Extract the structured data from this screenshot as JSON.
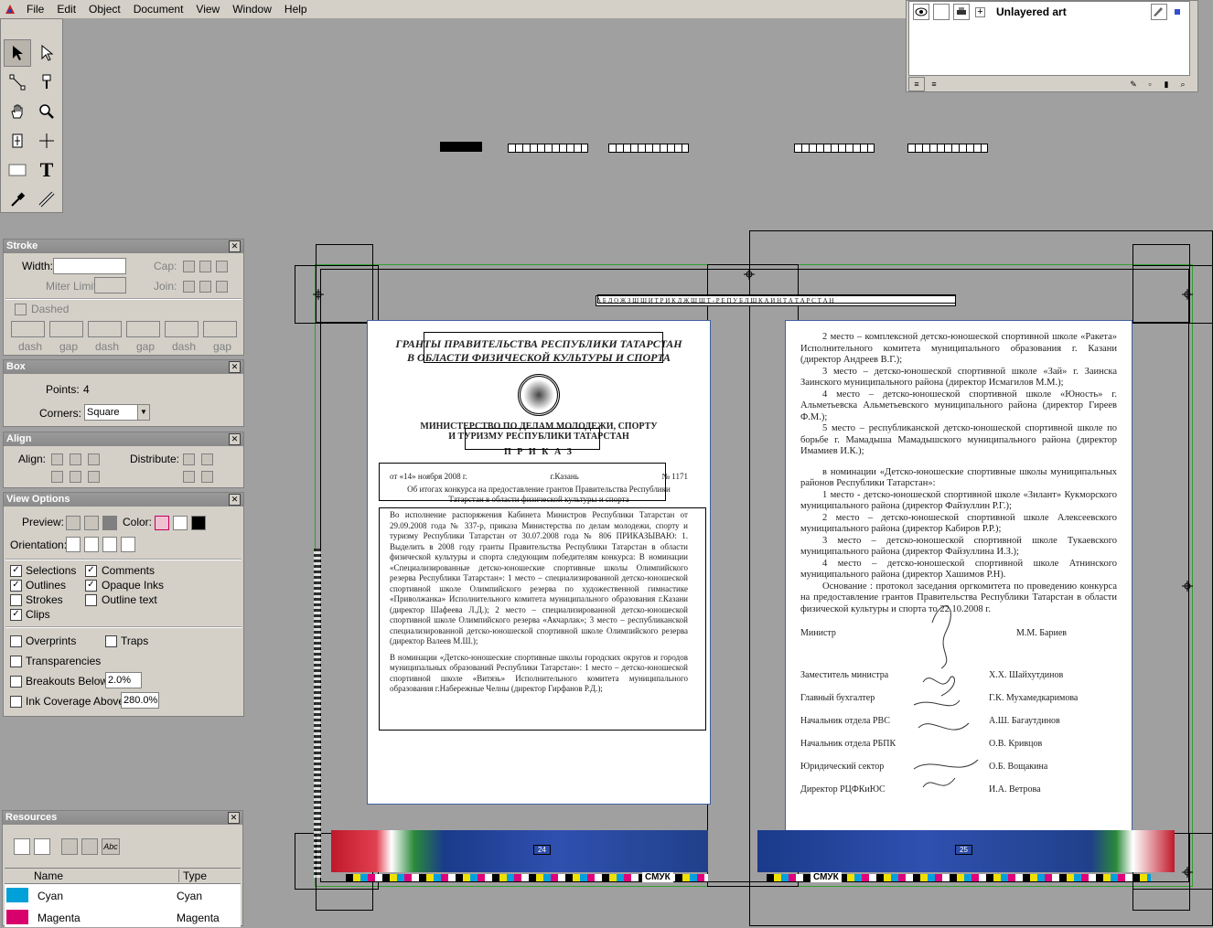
{
  "menubar": {
    "items": [
      "File",
      "Edit",
      "Object",
      "Document",
      "View",
      "Window",
      "Help"
    ]
  },
  "layers": {
    "layer_name": "Unlayered art"
  },
  "stroke_panel": {
    "title": "Stroke",
    "width_label": "Width:",
    "width_value": "",
    "cap_label": "Cap:",
    "miter_label": "Miter Limit:",
    "join_label": "Join:",
    "dashed_label": "Dashed",
    "dash_labels": [
      "dash",
      "gap",
      "dash",
      "gap",
      "dash",
      "gap"
    ]
  },
  "box_panel": {
    "title": "Box",
    "points_label": "Points:",
    "points_value": "4",
    "corners_label": "Corners:",
    "corners_value": "Square"
  },
  "align_panel": {
    "title": "Align",
    "align_label": "Align:",
    "distribute_label": "Distribute:"
  },
  "view_options": {
    "title": "View Options",
    "preview_label": "Preview:",
    "color_label": "Color:",
    "orientation_label": "Orientation:",
    "checks": [
      {
        "label": "Selections",
        "checked": true
      },
      {
        "label": "Comments",
        "checked": true
      },
      {
        "label": "Outlines",
        "checked": true
      },
      {
        "label": "Opaque Inks",
        "checked": true
      },
      {
        "label": "Strokes",
        "checked": false
      },
      {
        "label": "Outline text",
        "checked": false
      },
      {
        "label": "Clips",
        "checked": true
      }
    ],
    "overprints_label": "Overprints",
    "traps_label": "Traps",
    "transparencies_label": "Transparencies",
    "breakouts_label": "Breakouts Below",
    "breakouts_value": "2.0%",
    "ink_label": "Ink Coverage Above",
    "ink_value": "280.0%"
  },
  "resources": {
    "title": "Resources",
    "col_name": "Name",
    "col_type": "Type",
    "rows": [
      {
        "name": "Cyan",
        "type": "Cyan",
        "color": "#00a0d8"
      },
      {
        "name": "Magenta",
        "type": "Magenta",
        "color": "#d8006c"
      }
    ]
  },
  "document": {
    "left": {
      "title1": "ГРАНТЫ ПРАВИТЕЛЬСТВА РЕСПУБЛИКИ ТАТАРСТАН",
      "title2": "В ОБЛАСТИ ФИЗИЧЕСКОЙ КУЛЬТУРЫ И СПОРТА",
      "ministry1": "МИНИСТЕРСТВО ПО ДЕЛАМ МОЛОДЕЖИ, СПОРТУ",
      "ministry2": "И ТУРИЗМУ РЕСПУБЛИКИ ТАТАРСТАН",
      "prikaz": "П Р И К А З",
      "date": "от «14» ноября 2008 г.",
      "city": "г.Казань",
      "number": "№ 1171",
      "subject": "Об итогах конкурса на предоставление грантов Правительства Республики Татарстан в области физической культуры и спорта",
      "body": "Во исполнение распоряжения Кабинета Министров Республики Татарстан от 29.09.2008 года № 337-р, приказа Министерства по делам молодежи, спорту и туризму Республики Татарстан от 30.07.2008 года № 806 ПРИКАЗЫВАЮ: 1. Выделить в 2008 году гранты Правительства Республики Татарстан в области физической культуры и спорта следующим победителям конкурса: В номинации «Специализированные детско-юношеские спортивные школы Олимпийского резерва Республики Татарстан»: 1 место – специализированной детско-юношеской спортивной школе Олимпийского резерва по художественной гимнастике «Приволжанка» Исполнительного комитета муниципального образования г.Казани (директор Шафеева Л.Д.); 2 место – специализированной детско-юношеской спортивной школе Олимпийского резерва «Акчарлак»; 3 место – республиканской специализированной детско-юношеской спортивной школе Олимпийского резерва (директор Валеев М.Ш.);",
      "body2": "В номинации «Детско-юношеские спортивные школы городских округов и городов муниципальных образований Республики Татарстан»: 1 место – детско-юношеской спортивной школе «Витязь» Исполнительного комитета муниципального образования г.Набережные Челны (директор Гирфанов Р.Д.);",
      "page_no": "24"
    },
    "right": {
      "header": "А Б Д О Ж З Ш Ш И Т Р И К Д Ж Ш Ш Т - Р Е П У Б Л Ш К А И Н Т А Т А Р С Т А Н",
      "p1": "2 место – комплексной детско-юношеской спортивной школе «Ракета» Исполнительного комитета муниципального образования г. Казани (директор Андреев В.Г.);",
      "p2": "3 место – детско-юношеской спортивной школе «Зай» г. Заинска Заинского муниципального района (директор Исмагилов М.М.);",
      "p3": "4 место – детско-юношеской спортивной школе «Юность» г. Альметьевска Альметьевского муниципального района (директор Гиреев Ф.М.);",
      "p4": "5 место – республиканской детско-юношеской спортивной школе по борьбе г. Мамадыша Мамадышского муниципального района (директор Имамиев И.К.);",
      "p5": "в номинации «Детско-юношеские спортивные школы муниципальных районов Республики Татарстан»:",
      "p6": "1 место - детско-юношеской спортивной школе «Зилант» Кукморского муниципального района (директор Файзуллин Р.Г.);",
      "p7": "2 место – детско-юношеской спортивной школе Алексеевского муниципального района (директор Кабиров Р.Р.);",
      "p8": "3 место – детско-юношеской спортивной школе Тукаевского муниципального района (директор Файзуллина И.З.);",
      "p9": "4 место – детско-юношеской спортивной школе Атнинского муниципального района (директор Хашимов Р.Н).",
      "p10": "Основание : протокол заседания оргкомитета по проведению конкурса на предоставление грантов Правительства Республики Татарстан в области физической культуры и спорта то 22.10.2008 г.",
      "signatures": [
        {
          "role": "Министр",
          "name": "М.М. Бариев"
        },
        {
          "role": "Заместитель министра",
          "name": "Х.Х. Шайхутдинов"
        },
        {
          "role": "Главный бухгалтер",
          "name": "Г.К. Мухамедкаримова"
        },
        {
          "role": "Начальник отдела РВС",
          "name": "А.Ш. Багаутдинов"
        },
        {
          "role": "Начальник отдела РБПК",
          "name": "О.В. Кривцов"
        },
        {
          "role": "Юридический сектор",
          "name": "О.Б. Вощакина"
        },
        {
          "role": "Директор РЦФКиЮС",
          "name": "И.А. Ветрова"
        }
      ],
      "page_no": "25"
    },
    "footer_label": "СМУК"
  }
}
